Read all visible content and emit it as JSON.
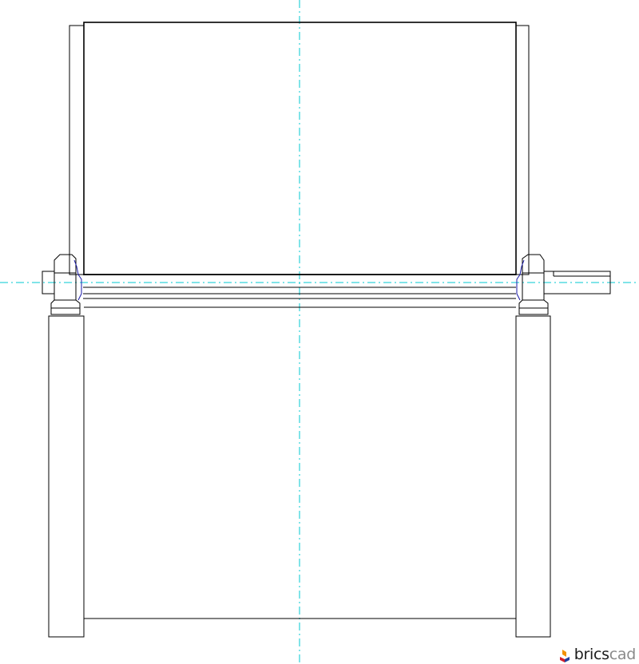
{
  "watermark": {
    "brand_part_1": "brics",
    "brand_part_2": "cad"
  },
  "colors": {
    "outline": "#000000",
    "centerline": "#00c8d2",
    "hidden_detail": "#1a1aa8",
    "background": "#ffffff",
    "brand_dark": "#1c1c1c",
    "brand_light": "#8a8a8a"
  },
  "icons": {
    "logo": "bricscad-logo-icon"
  }
}
